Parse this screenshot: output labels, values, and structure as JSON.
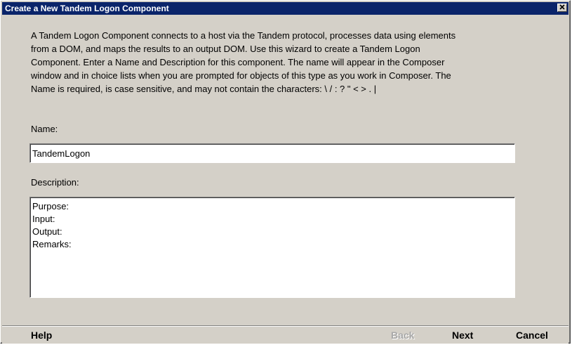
{
  "window": {
    "title": "Create a New Tandem Logon Component",
    "close_icon": "close-icon"
  },
  "intro": {
    "lines": [
      "A Tandem Logon Component connects to a host via the Tandem protocol, processes data using elements",
      "from a DOM, and maps the results to an output DOM.  Use this wizard to create a Tandem Logon",
      "Component.  Enter a Name and Description for this component.  The name will appear in the Composer",
      "window and in choice lists when you are prompted for objects of this type as you work in Composer.  The",
      "Name is required, is case sensitive, and may not contain the characters: \\ / : ? \" < > .  |"
    ]
  },
  "form": {
    "name_label": "Name:",
    "name_value": "TandemLogon",
    "description_label": "Description:",
    "description_lines": [
      "Purpose:",
      "Input:",
      "Output:",
      "Remarks:"
    ]
  },
  "buttons": {
    "help": "Help",
    "back": "Back",
    "next": "Next",
    "cancel": "Cancel"
  },
  "colors": {
    "titlebar": "#0a246a",
    "window_bg": "#d4d0c8",
    "disabled_text": "#a8a8a8"
  }
}
